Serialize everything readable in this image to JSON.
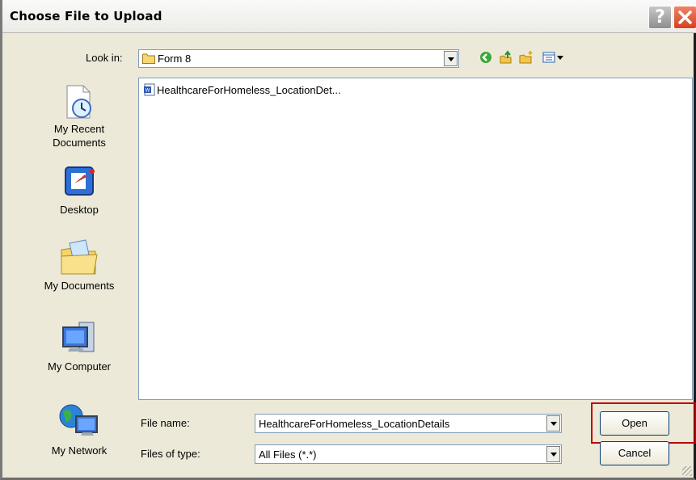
{
  "window": {
    "title": "Choose File to Upload"
  },
  "look_in": {
    "label": "Look in:",
    "value": "Form 8"
  },
  "places": [
    {
      "label": "My Recent Documents",
      "icon": "recent-documents-icon"
    },
    {
      "label": "Desktop",
      "icon": "desktop-icon"
    },
    {
      "label": "My Documents",
      "icon": "my-documents-icon"
    },
    {
      "label": "My Computer",
      "icon": "my-computer-icon"
    },
    {
      "label": "My Network",
      "icon": "my-network-icon"
    }
  ],
  "files": [
    {
      "name": "HealthcareForHomeless_LocationDet...",
      "icon": "word-document-icon"
    }
  ],
  "file_name": {
    "label": "File name:",
    "value": "HealthcareForHomeless_LocationDetails"
  },
  "file_type": {
    "label": "Files of type:",
    "value": "All Files (*.*)"
  },
  "buttons": {
    "open": "Open",
    "cancel": "Cancel",
    "help": "?"
  },
  "colors": {
    "highlight": "#c00000",
    "list_border": "#7f9db9"
  }
}
